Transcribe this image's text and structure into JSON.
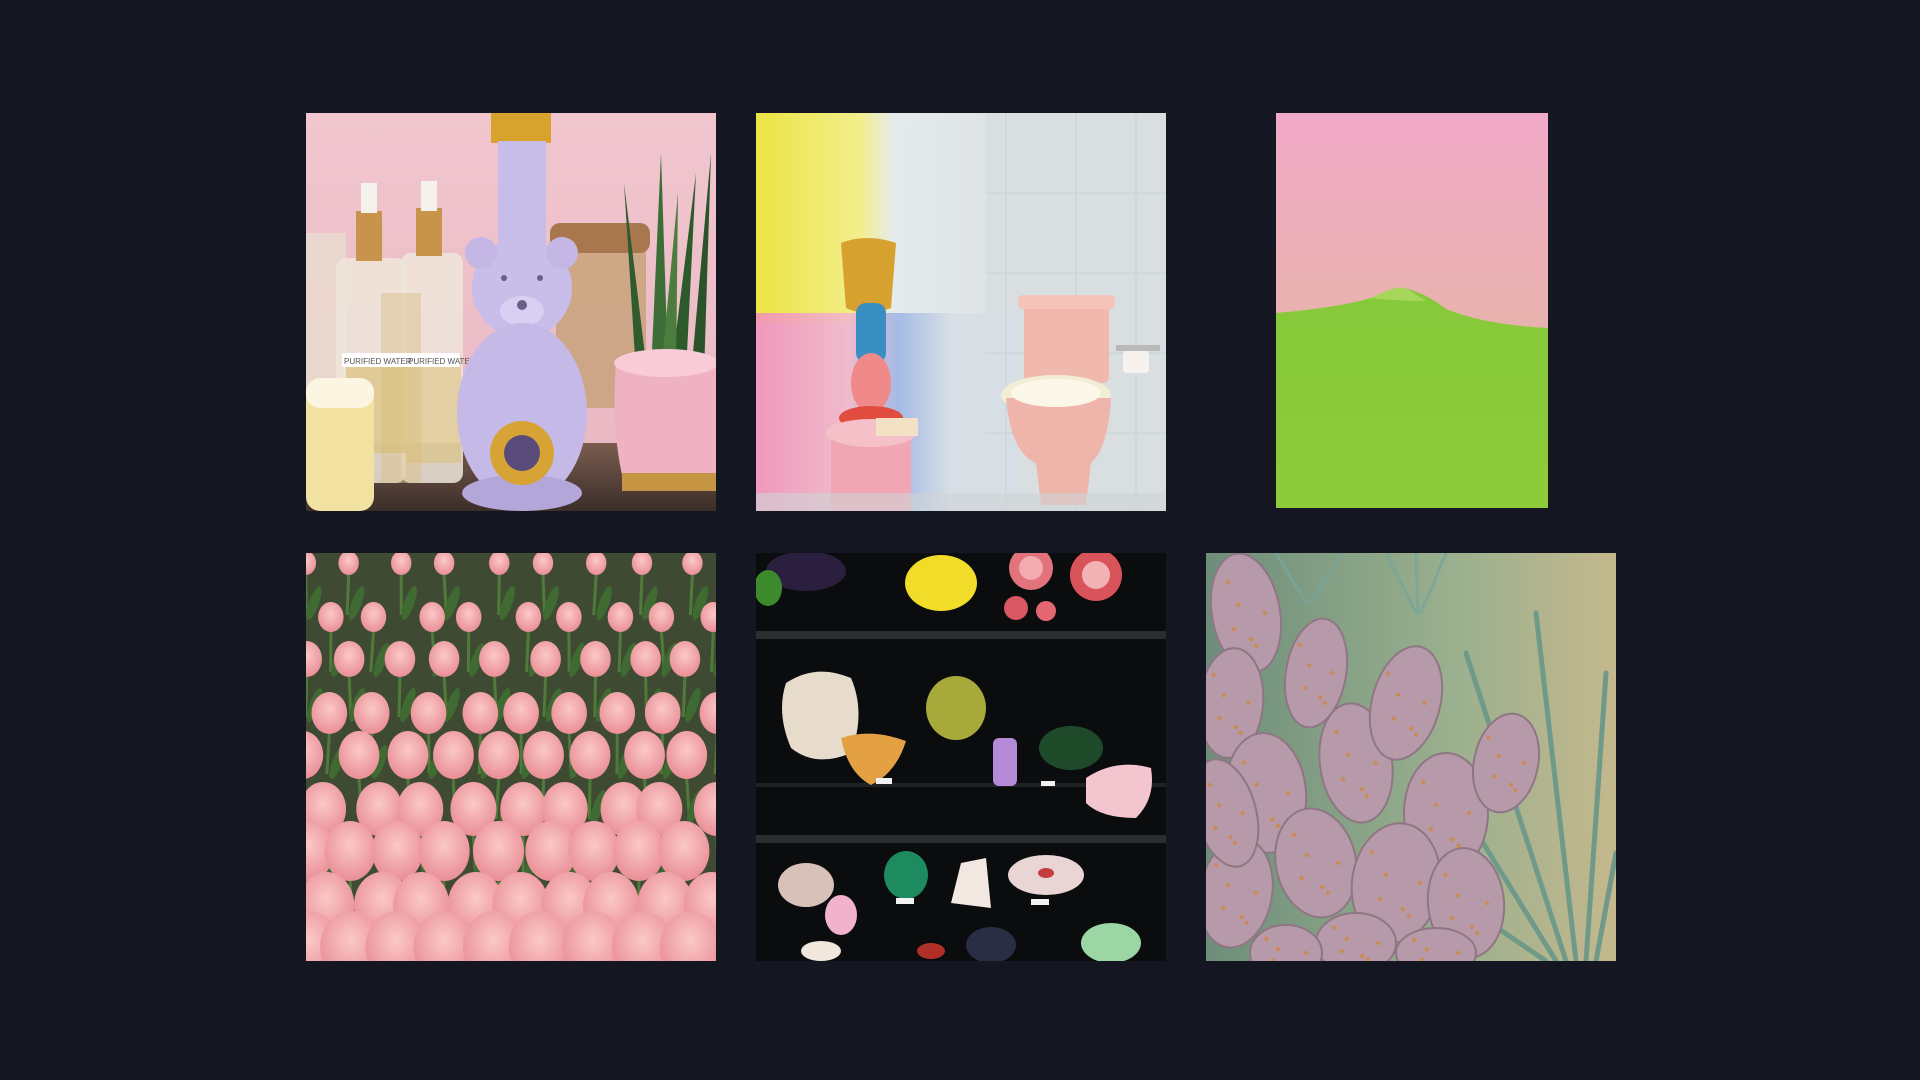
{
  "gallery": {
    "tiles": [
      {
        "subject": "bear-shaped vase with serum bottles and snake plant",
        "accent": "#f0c2cc"
      },
      {
        "subject": "pastel bathroom with rainbow shower curtain and pink toilet",
        "accent": "#f2a7b8"
      },
      {
        "subject": "green hill under pink sky",
        "accent": "#8ccc3c"
      },
      {
        "subject": "field of pink tulips",
        "accent": "#f3a1a6"
      },
      {
        "subject": "mineral specimens in glass display case",
        "accent": "#0d0d0f"
      },
      {
        "subject": "prickly pear cactus garden",
        "accent": "#b89aa8"
      }
    ]
  },
  "labels": {
    "bottle_label_1": "PURIFIED WATER",
    "bottle_label_2": "PURIFIED WATER"
  }
}
